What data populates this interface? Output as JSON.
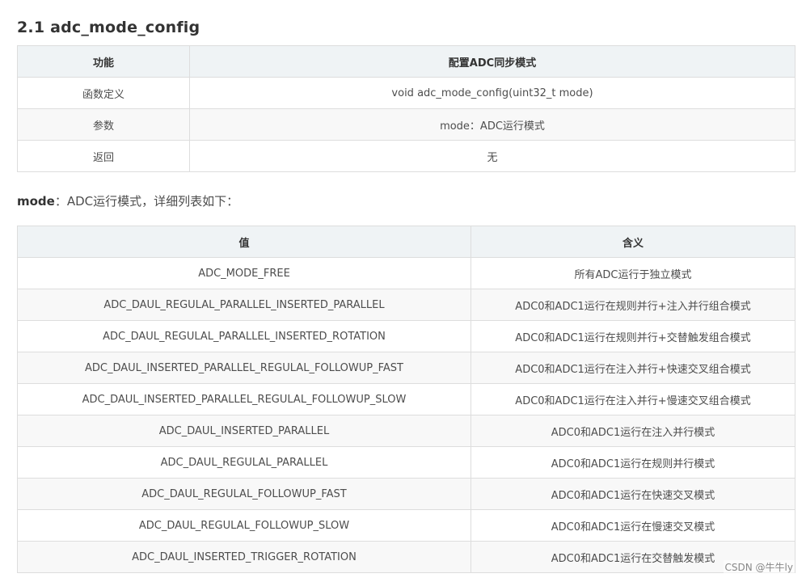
{
  "section": {
    "title": "2.1 adc_mode_config"
  },
  "func_table": {
    "headers": [
      "功能",
      "配置ADC同步模式"
    ],
    "rows": [
      [
        "函数定义",
        "void adc_mode_config(uint32_t mode)"
      ],
      [
        "参数",
        "mode：ADC运行模式"
      ],
      [
        "返回",
        "无"
      ]
    ]
  },
  "param_desc": {
    "name": "mode",
    "text": "：ADC运行模式，详细列表如下："
  },
  "mode_table": {
    "headers": [
      "值",
      "含义"
    ],
    "rows": [
      [
        "ADC_MODE_FREE",
        "所有ADC运行于独立模式"
      ],
      [
        "ADC_DAUL_REGULAL_PARALLEL_INSERTED_PARALLEL",
        "ADC0和ADC1运行在规则并行+注入并行组合模式"
      ],
      [
        "ADC_DAUL_REGULAL_PARALLEL_INSERTED_ROTATION",
        "ADC0和ADC1运行在规则并行+交替触发组合模式"
      ],
      [
        "ADC_DAUL_INSERTED_PARALLEL_REGULAL_FOLLOWUP_FAST",
        "ADC0和ADC1运行在注入并行+快速交叉组合模式"
      ],
      [
        "ADC_DAUL_INSERTED_PARALLEL_REGULAL_FOLLOWUP_SLOW",
        "ADC0和ADC1运行在注入并行+慢速交叉组合模式"
      ],
      [
        "ADC_DAUL_INSERTED_PARALLEL",
        "ADC0和ADC1运行在注入并行模式"
      ],
      [
        "ADC_DAUL_REGULAL_PARALLEL",
        "ADC0和ADC1运行在规则并行模式"
      ],
      [
        "ADC_DAUL_REGULAL_FOLLOWUP_FAST",
        "ADC0和ADC1运行在快速交叉模式"
      ],
      [
        "ADC_DAUL_REGULAL_FOLLOWUP_SLOW",
        "ADC0和ADC1运行在慢速交叉模式"
      ],
      [
        "ADC_DAUL_INSERTED_TRIGGER_ROTATION",
        "ADC0和ADC1运行在交替触发模式"
      ]
    ]
  },
  "watermark": "CSDN @牛牛ly"
}
